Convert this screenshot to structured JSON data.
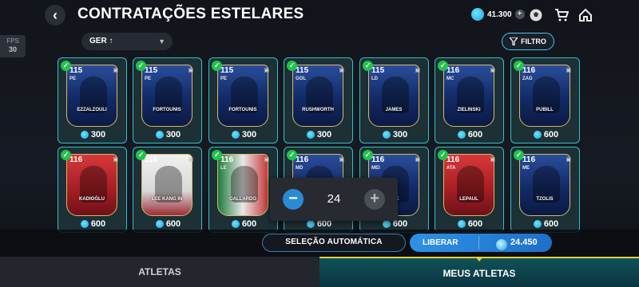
{
  "header": {
    "back_icon": "chevron-left-icon",
    "title": "CONTRATAÇÕES ESTELARES",
    "coins": "41.300",
    "icons": [
      "plus-icon",
      "soccer-ball-icon",
      "shopping-cart-icon",
      "home-icon"
    ]
  },
  "fps": {
    "label": "FPS",
    "value": "30"
  },
  "sort": {
    "label": "GER ↑"
  },
  "filter": {
    "label": "FILTRO"
  },
  "cards_row1": [
    {
      "rating": "115",
      "pos": "PE",
      "name": "EZZALZOULI",
      "price": "300",
      "style": "blue"
    },
    {
      "rating": "115",
      "pos": "PE",
      "name": "FORTOUNIS",
      "price": "300",
      "style": "blue"
    },
    {
      "rating": "115",
      "pos": "PE",
      "name": "FORTOUNIS",
      "price": "300",
      "style": "blue"
    },
    {
      "rating": "115",
      "pos": "GOL",
      "name": "RUSHWORTH",
      "price": "300",
      "style": "blue"
    },
    {
      "rating": "115",
      "pos": "LD",
      "name": "JAMES",
      "price": "300",
      "style": "blue"
    },
    {
      "rating": "116",
      "pos": "MC",
      "name": "ZIELINSKI",
      "price": "600",
      "style": "blue"
    },
    {
      "rating": "116",
      "pos": "ZAG",
      "name": "PUBILL",
      "price": "600",
      "style": "blue"
    }
  ],
  "cards_row2": [
    {
      "rating": "116",
      "pos": "",
      "name": "KADIOĞLU",
      "price": "600",
      "style": "red"
    },
    {
      "rating": "116",
      "pos": "PD",
      "name": "LEE KANG IN",
      "price": "600",
      "style": "white"
    },
    {
      "rating": "116",
      "pos": "LE",
      "name": "GALLARDO",
      "price": "600",
      "style": "green"
    },
    {
      "rating": "116",
      "pos": "MD",
      "name": "",
      "price": "600",
      "style": "blue"
    },
    {
      "rating": "116",
      "pos": "MEI",
      "name": "CHE",
      "price": "600",
      "style": "blue"
    },
    {
      "rating": "116",
      "pos": "ATA",
      "name": "LEPAUL",
      "price": "600",
      "style": "red"
    },
    {
      "rating": "116",
      "pos": "ME",
      "name": "TZOLIS",
      "price": "600",
      "style": "blue"
    }
  ],
  "stepper": {
    "value": "24",
    "minus_icon": "minus-icon",
    "plus_icon": "plus-icon"
  },
  "actions": {
    "auto_select": "SELEÇÃO AUTOMÁTICA",
    "release": "LIBERAR",
    "release_amount": "24.450"
  },
  "tabs": {
    "athletes": "ATLETAS",
    "my_athletes": "MEUS ATLETAS"
  },
  "colors": {
    "accent": "#36bfc7",
    "coin": "#1aa5d8",
    "check": "#20c54a",
    "tab_indicator": "#e8d030"
  }
}
